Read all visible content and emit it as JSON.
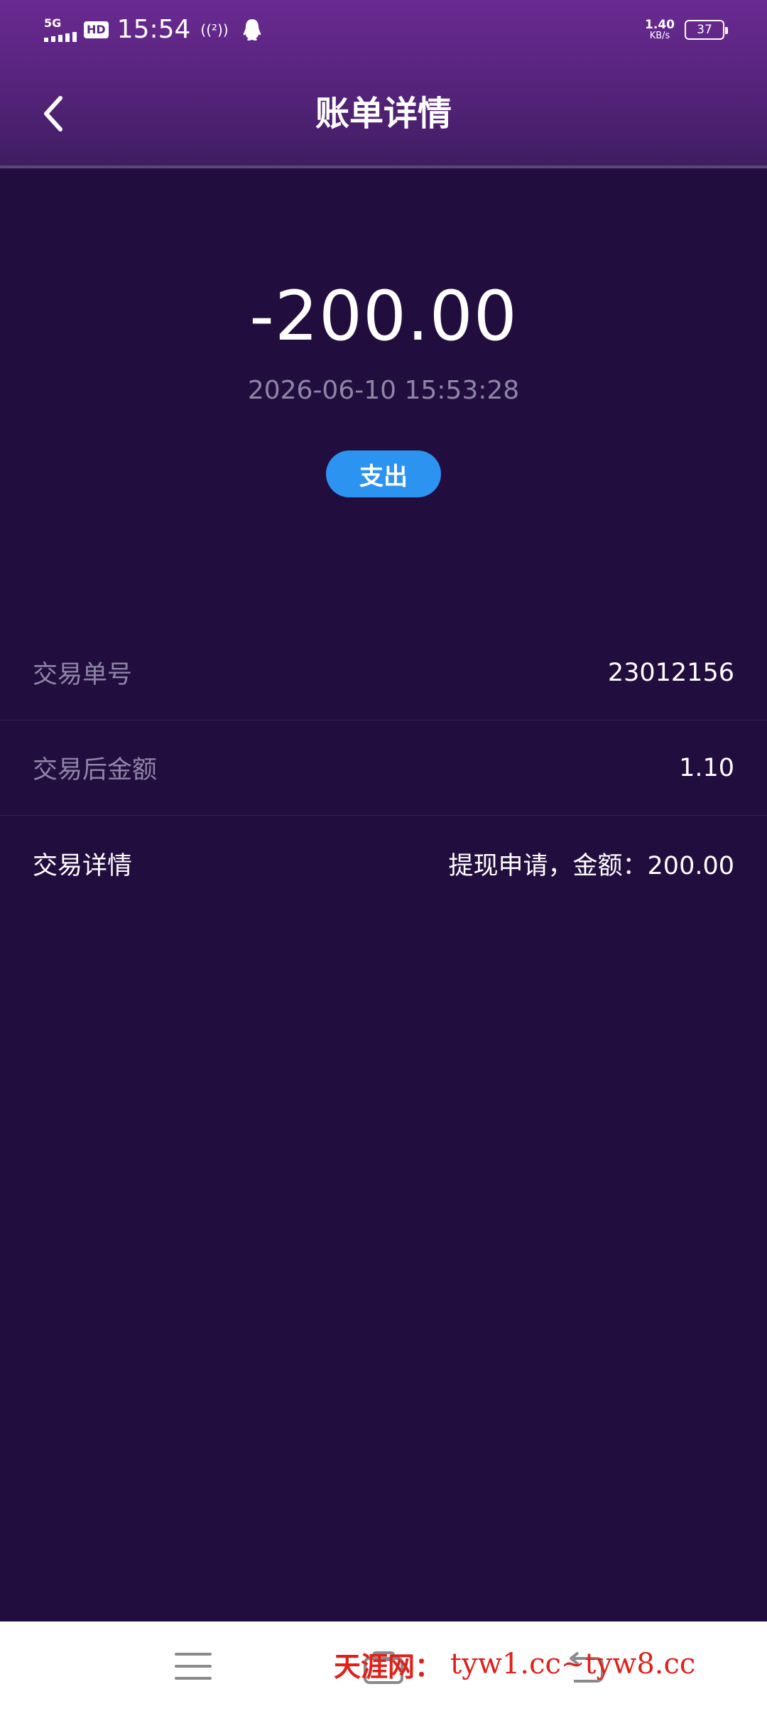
{
  "status_bar": {
    "network": "5G",
    "hd": "HD",
    "time": "15:54",
    "hotspot": "((²))",
    "net_speed_value": "1.40",
    "net_speed_unit": "KB/s",
    "battery": "37"
  },
  "header": {
    "title": "账单详情"
  },
  "summary": {
    "amount": "-200.00",
    "datetime": "2026-06-10 15:53:28",
    "type_label": "支出"
  },
  "details": [
    {
      "label": "交易单号",
      "value": "23012156"
    },
    {
      "label": "交易后金额",
      "value": "1.10"
    },
    {
      "label": "交易详情",
      "value": "提现申请，金额：200.00"
    }
  ],
  "watermark": {
    "site_name": "天涯网：",
    "urls": "tyw1.cc~tyw8.cc"
  },
  "colors": {
    "background": "#220e3e",
    "header_top": "#6a2a92",
    "badge_blue": "#2c93f0",
    "muted_text": "#8e86a6",
    "watermark_red": "#e0201a"
  }
}
